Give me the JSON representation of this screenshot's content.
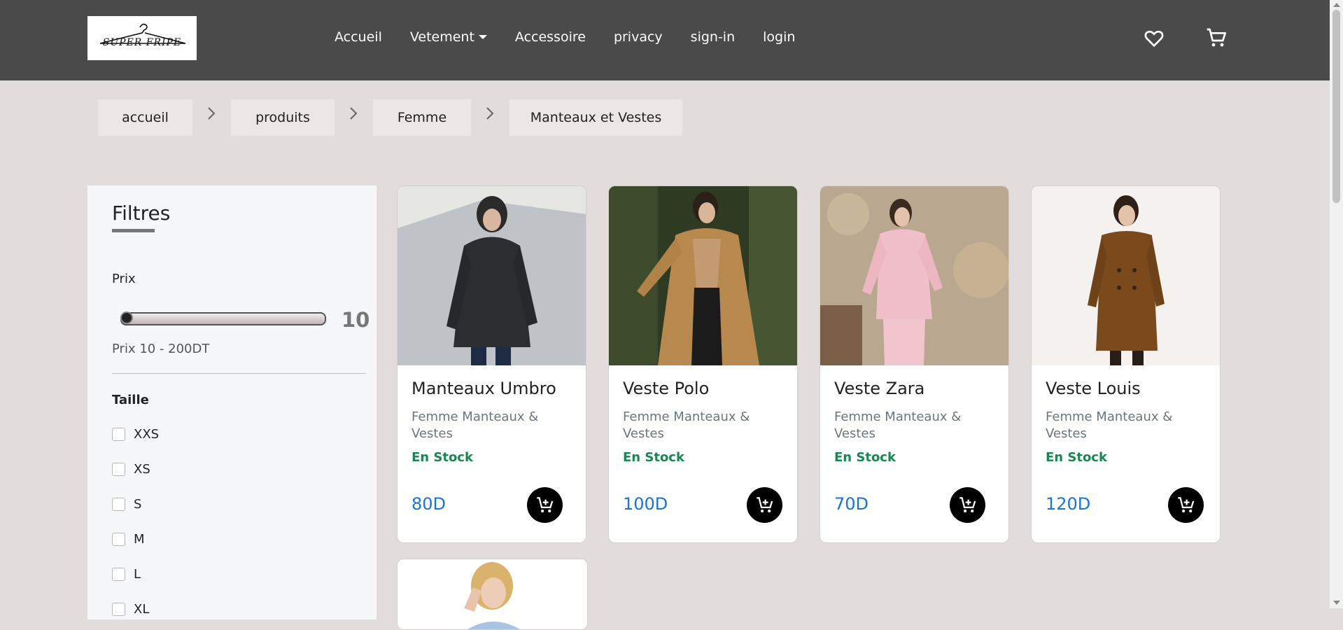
{
  "header": {
    "logo_text": "SUPER FRIPE",
    "nav": [
      "Accueil",
      "Vetement",
      "Accessoire",
      "privacy",
      "sign-in",
      "login"
    ],
    "icons": [
      "heart-icon",
      "cart-icon"
    ]
  },
  "breadcrumb": [
    "accueil",
    "produits",
    "Femme",
    "Manteaux et Vestes"
  ],
  "filters": {
    "title": "Filtres",
    "price_label": "Prix",
    "slider_value": "10",
    "price_range": "Prix 10 - 200DT",
    "size_label": "Taille",
    "sizes": [
      "XXS",
      "XS",
      "S",
      "M",
      "L",
      "XL"
    ]
  },
  "products": [
    {
      "name": "Manteaux Umbro",
      "category": "Femme Manteaux & Vestes",
      "stock": "En Stock",
      "price": "80D"
    },
    {
      "name": "Veste Polo",
      "category": "Femme Manteaux & Vestes",
      "stock": "En Stock",
      "price": "100D"
    },
    {
      "name": "Veste Zara",
      "category": "Femme Manteaux & Vestes",
      "stock": "En Stock",
      "price": "70D"
    },
    {
      "name": "Veste Louis",
      "category": "Femme Manteaux & Vestes",
      "stock": "En Stock",
      "price": "120D"
    }
  ],
  "colors": {
    "navbar": "#4a4a4a",
    "background": "#e2dcdc",
    "price": "#1a73d9",
    "stock": "#198754"
  }
}
